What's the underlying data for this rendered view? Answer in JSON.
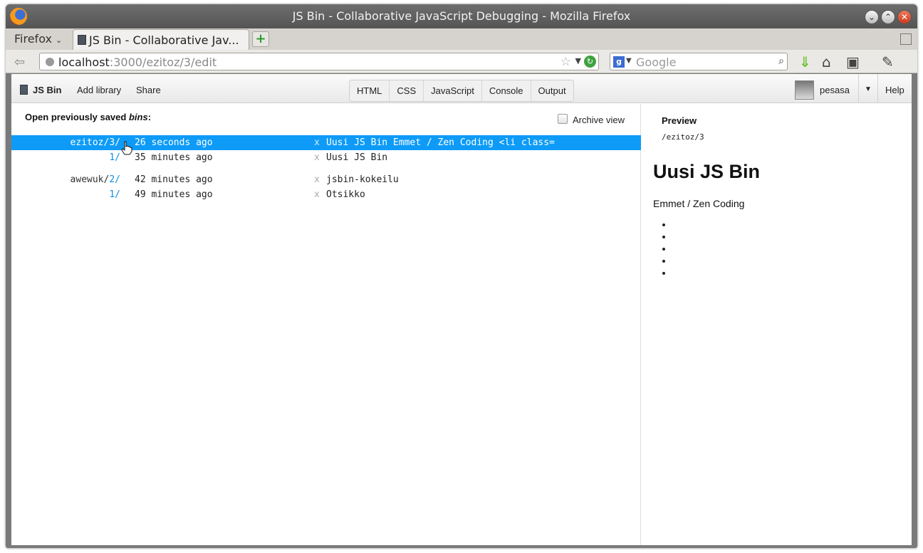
{
  "window": {
    "title": "JS Bin - Collaborative JavaScript Debugging - Mozilla Firefox"
  },
  "tabstrip": {
    "menu_label": "Firefox",
    "active_tab_label": "JS Bin - Collaborative Jav...",
    "new_tab_label": "+"
  },
  "navbar": {
    "url_host": "localhost",
    "url_path": ":3000/ezitoz/3/edit",
    "search_placeholder": "Google"
  },
  "jsbin": {
    "logo": "JS Bin",
    "add_library": "Add library",
    "share": "Share",
    "panels": [
      "HTML",
      "CSS",
      "JavaScript",
      "Console",
      "Output"
    ],
    "username": "pesasa",
    "help": "Help"
  },
  "bins": {
    "heading_prefix": "Open previously saved ",
    "heading_emph": "bins",
    "heading_suffix": ":",
    "archive_label": "Archive view",
    "rows": [
      {
        "name": "ezitoz/",
        "rev": "3/",
        "time": "26 seconds ago",
        "x": "x",
        "title": "Uusi JS Bin Emmet / Zen Coding <li class="
      },
      {
        "name": "",
        "rev": "1/",
        "time": "35 minutes ago",
        "x": "x",
        "title": "Uusi JS Bin"
      },
      {
        "name": "awewuk/",
        "rev": "2/",
        "time": "42 minutes ago",
        "x": "x",
        "title": "jsbin-kokeilu"
      },
      {
        "name": "",
        "rev": "1/",
        "time": "49 minutes ago",
        "x": "x",
        "title": "Otsikko"
      }
    ]
  },
  "preview": {
    "label": "Preview",
    "path": "/ezitoz/3",
    "heading": "Uusi JS Bin",
    "paragraph": "Emmet / Zen Coding",
    "list_item_count": 5
  },
  "colors": {
    "selection": "#0d9bf7",
    "revision_link": "#0e8fe6"
  }
}
